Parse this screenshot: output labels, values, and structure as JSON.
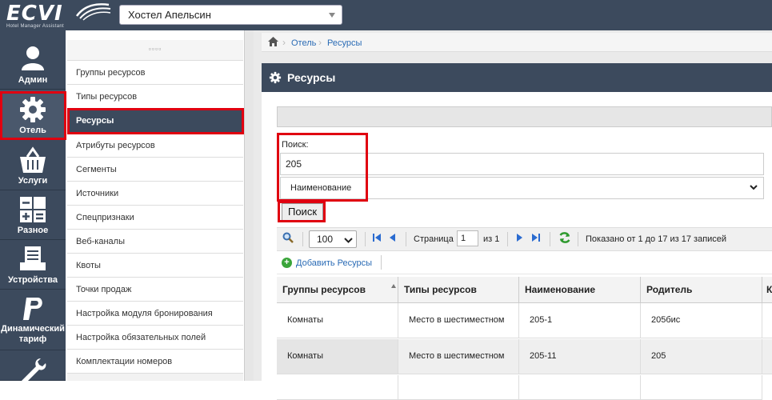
{
  "app": {
    "logo_text": "ECVI",
    "logo_subtitle": "Hotel Manager Assistant",
    "hotel_selected": "Хостел Апельсин"
  },
  "nav": {
    "items": [
      {
        "label": "Админ",
        "icon": "user-icon"
      },
      {
        "label": "Отель",
        "icon": "gear-icon"
      },
      {
        "label": "Услуги",
        "icon": "basket-icon"
      },
      {
        "label": "Разное",
        "icon": "calculator-icon"
      },
      {
        "label": "Устройства",
        "icon": "printer-icon"
      },
      {
        "label": "Динамический тариф",
        "icon": "paypal-icon"
      },
      {
        "label": "",
        "icon": "wrench-icon"
      }
    ],
    "active": "Отель"
  },
  "submenu": {
    "handle": "▫▫▫▫",
    "items": [
      "Группы ресурсов",
      "Типы ресурсов",
      "Ресурсы",
      "Атрибуты ресурсов",
      "Сегменты",
      "Источники",
      "Спецпризнаки",
      "Веб-каналы",
      "Квоты",
      "Точки продаж",
      "Настройка модуля бронирования",
      "Настройка обязательных полей",
      "Комплектации номеров"
    ],
    "active": "Ресурсы"
  },
  "breadcrumb": [
    "Отель",
    "Ресурсы"
  ],
  "panel": {
    "title": "Ресурсы"
  },
  "search": {
    "label": "Поиск:",
    "value": "205",
    "field": "Наименование",
    "button": "Поиск"
  },
  "pager": {
    "page_size": "100",
    "page_label": "Страница",
    "page": "1",
    "of_label": "из 1",
    "info": "Показано от 1 до 17 из 17 записей"
  },
  "toolbar": {
    "add_label": "Добавить Ресурсы"
  },
  "table": {
    "columns": [
      "Группы ресурсов",
      "Типы ресурсов",
      "Наименование",
      "Родитель",
      "К"
    ],
    "rows": [
      [
        "Комнаты",
        "Место в шестиместном",
        "205-1",
        "205бис"
      ],
      [
        "Комнаты",
        "Место в шестиместном",
        "205-11",
        "205"
      ]
    ]
  },
  "colors": {
    "nav_bg": "#3c4a5d",
    "highlight": "#e00010",
    "link": "#2a6bb5"
  }
}
